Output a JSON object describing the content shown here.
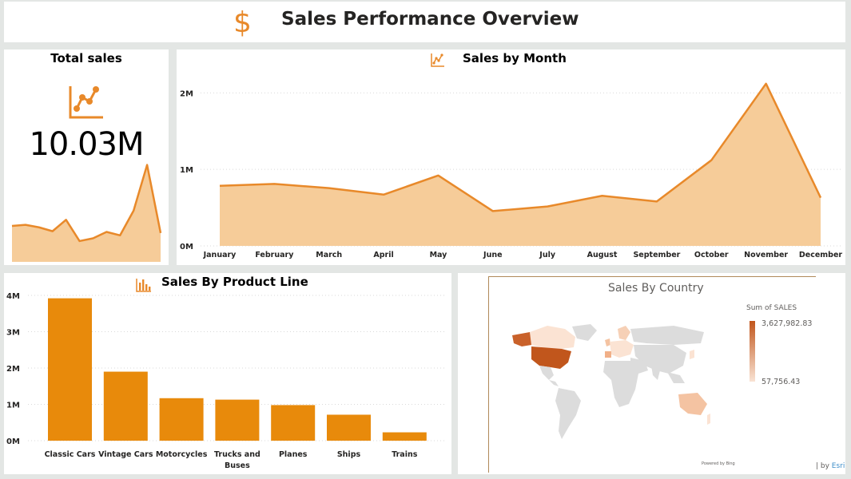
{
  "header": {
    "title": "Sales Performance Overview",
    "icon": "dollar-icon",
    "icon_glyph": "$"
  },
  "total_sales": {
    "title": "Total sales",
    "value": "10.03M",
    "icon": "line-chart-icon"
  },
  "colors": {
    "accent": "#e8892a",
    "area_fill": "#f6cc99",
    "bar": "#e88a0b",
    "map_max": "#c1561c",
    "map_min": "#f9e3d4"
  },
  "sales_by_month": {
    "title": "Sales by Month",
    "icon": "line-chart-icon",
    "chart_data": {
      "type": "area",
      "categories": [
        "January",
        "February",
        "March",
        "April",
        "May",
        "June",
        "July",
        "August",
        "September",
        "October",
        "November",
        "December"
      ],
      "values": [
        785000,
        810000,
        755000,
        670000,
        920000,
        455000,
        515000,
        655000,
        580000,
        1120000,
        2120000,
        630000
      ],
      "ylim": [
        0,
        2400000
      ],
      "yticks": [
        0,
        1000000,
        2000000
      ],
      "ytick_labels": [
        "0M",
        "1M",
        "2M"
      ],
      "grid": true
    }
  },
  "sales_by_product_line": {
    "title": "Sales By Product Line",
    "icon": "bar-chart-icon",
    "chart_data": {
      "type": "bar",
      "categories": [
        "Classic Cars",
        "Vintage Cars",
        "Motorcycles",
        "Trucks and Buses",
        "Planes",
        "Ships",
        "Trains"
      ],
      "category_lines": [
        [
          "Classic Cars"
        ],
        [
          "Vintage Cars"
        ],
        [
          "Motorcycles"
        ],
        [
          "Trucks and",
          "Buses"
        ],
        [
          "Planes"
        ],
        [
          "Ships"
        ],
        [
          "Trains"
        ]
      ],
      "values": [
        3920000,
        1900000,
        1170000,
        1130000,
        980000,
        715000,
        230000
      ],
      "ylim": [
        0,
        4000000
      ],
      "yticks": [
        0,
        1000000,
        2000000,
        3000000,
        4000000
      ],
      "ytick_labels": [
        "0M",
        "1M",
        "2M",
        "3M",
        "4M"
      ],
      "grid": true
    }
  },
  "sales_by_country": {
    "title": "Sales By Country",
    "legend_title": "Sum of SALES",
    "legend_max": "3,627,982.83",
    "legend_min": "57,756.43",
    "attribution": "Powered by Bing",
    "esri_prefix": "| by ",
    "esri_brand": "Esri"
  }
}
